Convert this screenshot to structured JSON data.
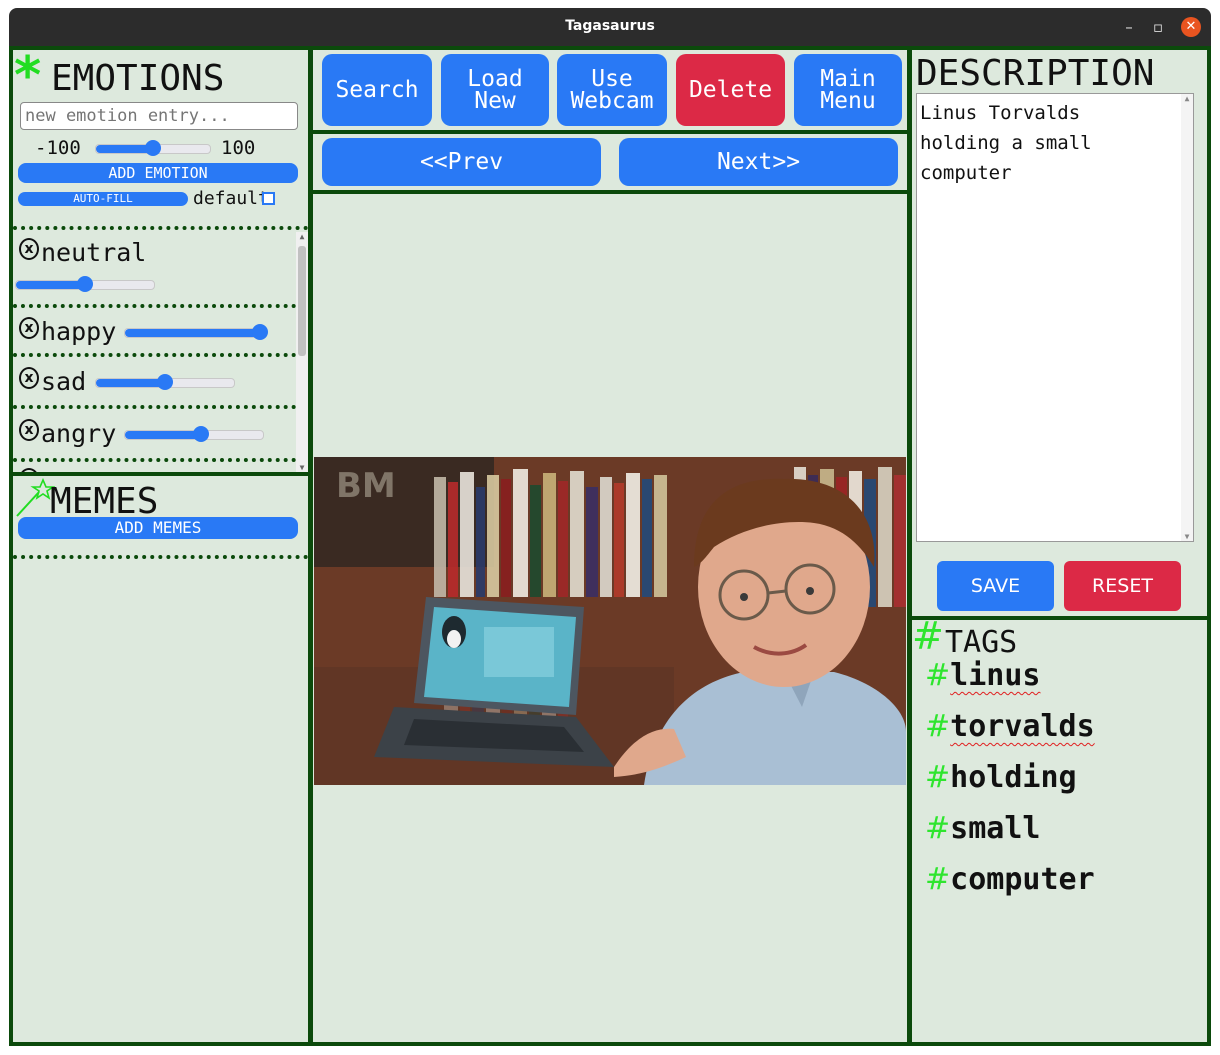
{
  "window": {
    "title": "Tagasaurus"
  },
  "emotions": {
    "heading": "EMOTIONS",
    "input_placeholder": "new emotion entry...",
    "range_min": "-100",
    "range_max": "100",
    "new_slider_value": 0,
    "add_label": "ADD EMOTION",
    "autofill_label": "AUTO-FILL",
    "default_label": "default",
    "items": [
      {
        "label": "neutral",
        "value": 0
      },
      {
        "label": "happy",
        "value": 95
      },
      {
        "label": "sad",
        "value": 0
      },
      {
        "label": "angry",
        "value": 10
      }
    ]
  },
  "memes": {
    "heading": "MEMES",
    "add_label": "ADD MEMES"
  },
  "toolbar": {
    "search": "Search",
    "load_new": "Load New",
    "use_webcam": "Use Webcam",
    "delete": "Delete",
    "main_menu": "Main Menu",
    "prev": "<<Prev",
    "next": "Next>>"
  },
  "description": {
    "heading": "DESCRIPTION",
    "text": "Linus Torvalds holding a small computer",
    "save_label": "SAVE",
    "reset_label": "RESET"
  },
  "tags": {
    "heading": "TAGS",
    "items": [
      "linus",
      "torvalds",
      "holding",
      "small",
      "computer"
    ]
  },
  "colors": {
    "accent": "#2979f5",
    "danger": "#dc2946",
    "panel_bg": "#dde9dd",
    "border": "#0b4a0b",
    "hash_green": "#2ee52e"
  }
}
